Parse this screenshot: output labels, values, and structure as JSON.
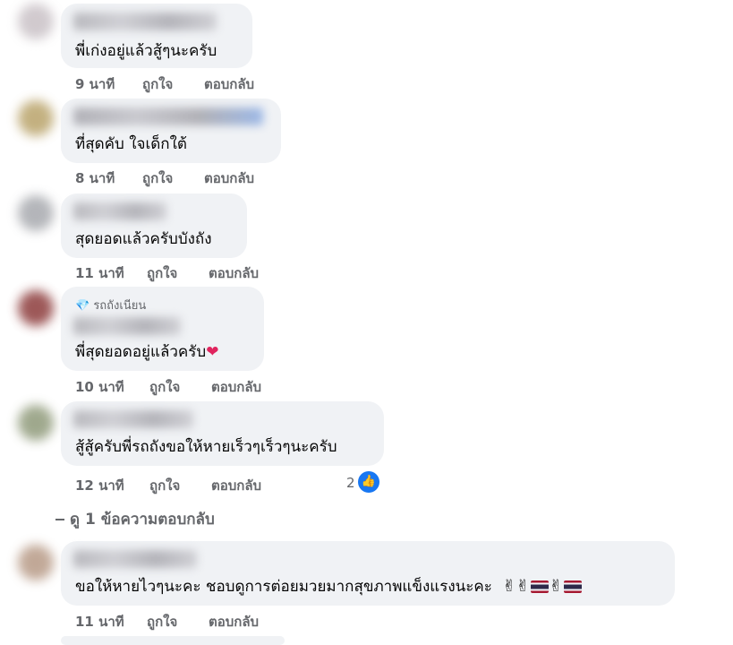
{
  "comments": [
    {
      "text": "พี่เก่งอยู่แล้วสู้ๆนะครับ",
      "time": "9 นาที",
      "like": "ถูกใจ",
      "reply": "ตอบกลับ"
    },
    {
      "text": "ที่สุดคับ ใจเด็กใต้",
      "time": "8 นาที",
      "like": "ถูกใจ",
      "reply": "ตอบกลับ"
    },
    {
      "text": "สุดยอดแล้วครับบังถัง",
      "time": "11 นาที",
      "like": "ถูกใจ",
      "reply": "ตอบกลับ"
    },
    {
      "badge": "รถถังเนียน",
      "text": "พี่สุดยอดอยู่แล้วครับ",
      "emoji": "❤",
      "time": "10 นาที",
      "like": "ถูกใจ",
      "reply": "ตอบกลับ"
    },
    {
      "text": "สู้สู้ครับพี่รถถังขอให้หายเร็วๆเร็วๆนะครับ",
      "time": "12 นาที",
      "like": "ถูกใจ",
      "reply": "ตอบกลับ",
      "reaction_count": "2"
    },
    {
      "text": "ขอให้หายไวๆนะคะ ชอบดูการต่อยมวยมากสุขภาพแข็งแรงนะคะ",
      "time": "11 นาที",
      "like": "ถูกใจ",
      "reply": "ตอบกลับ"
    }
  ],
  "view_replies": "ดู 1 ข้อความตอบกลับ",
  "icons": {
    "badge": "diamond-icon",
    "like": "thumbs-up-icon"
  },
  "colors": {
    "bubble": "#f0f2f5",
    "meta": "#65676b",
    "like_blue": "#1877f2"
  }
}
